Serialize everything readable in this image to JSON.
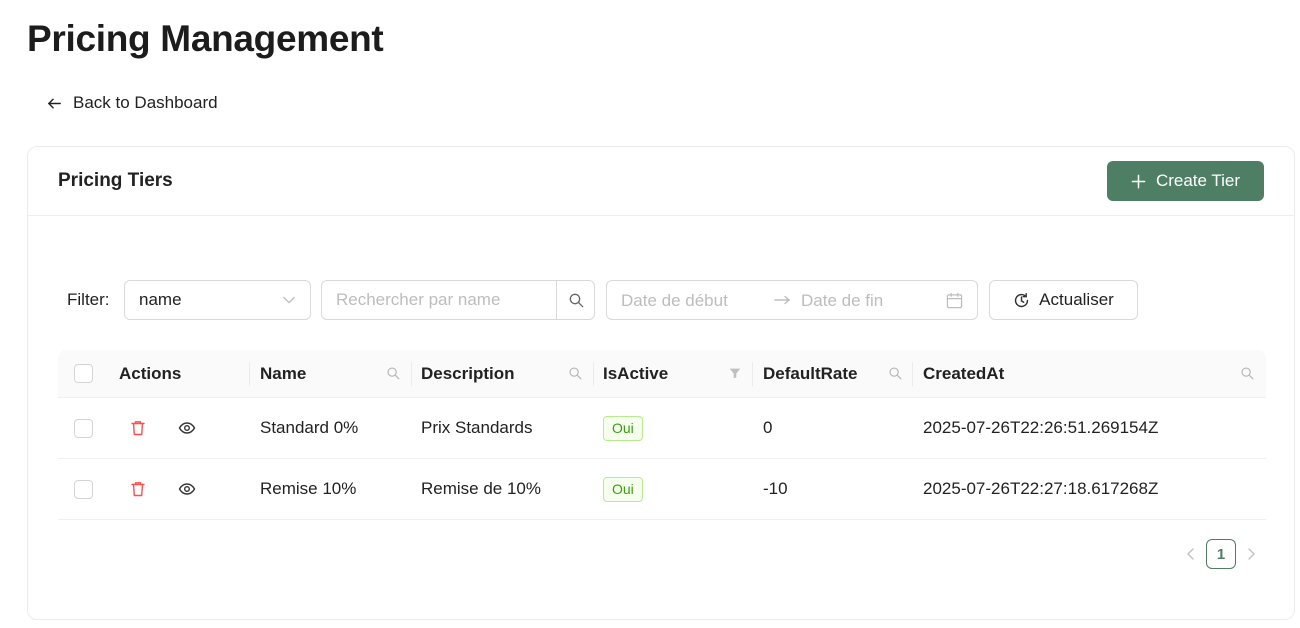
{
  "page": {
    "title": "Pricing Management"
  },
  "nav": {
    "back_label": "Back to Dashboard"
  },
  "card": {
    "title": "Pricing Tiers",
    "create_label": "Create Tier"
  },
  "filter": {
    "label": "Filter:",
    "field_value": "name",
    "search_placeholder": "Rechercher par name",
    "date_start_placeholder": "Date de début",
    "date_end_placeholder": "Date de fin",
    "refresh_label": "Actualiser"
  },
  "table": {
    "columns": [
      "Actions",
      "Name",
      "Description",
      "IsActive",
      "DefaultRate",
      "CreatedAt"
    ],
    "rows": [
      {
        "name": "Standard 0%",
        "description": "Prix Standards",
        "is_active": "Oui",
        "default_rate": "0",
        "created_at": "2025-07-26T22:26:51.269154Z"
      },
      {
        "name": "Remise 10%",
        "description": "Remise de 10%",
        "is_active": "Oui",
        "default_rate": "-10",
        "created_at": "2025-07-26T22:27:18.617268Z"
      }
    ]
  },
  "pagination": {
    "current_page": "1"
  },
  "colors": {
    "primary": "#4e7f64",
    "danger": "#ff4d4f",
    "badge_text": "#389e0d",
    "badge_bg": "#f6ffed",
    "badge_border": "#b7eb8f"
  },
  "icons": {
    "back": "arrow-left-icon",
    "create": "plus-icon",
    "select": "chevron-down-icon",
    "search": "search-icon",
    "date_arrow": "arrow-right-icon",
    "calendar": "calendar-icon",
    "refresh": "history-icon",
    "column_search": "search-icon",
    "column_filter": "filter-icon",
    "delete": "trash-icon",
    "view": "eye-icon",
    "prev": "chevron-left-icon",
    "next": "chevron-right-icon"
  }
}
